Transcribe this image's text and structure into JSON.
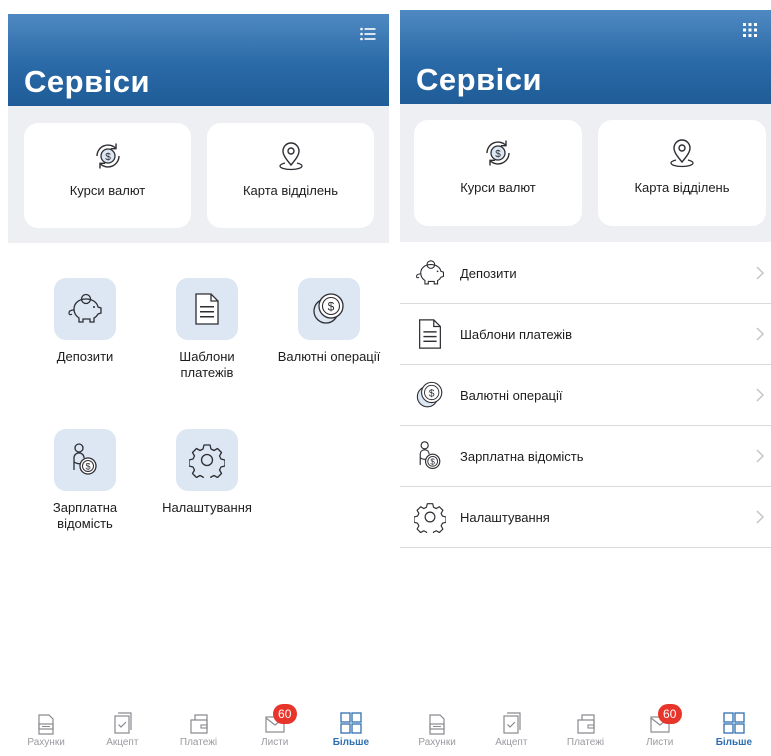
{
  "left_screen": {
    "title": "Сервіси",
    "view_toggle_icon": "list-icon",
    "quick_actions": [
      {
        "label": "Курси валют",
        "icon": "currency-exchange-icon"
      },
      {
        "label": "Карта відділень",
        "icon": "map-pin-icon"
      }
    ],
    "grid_items": [
      {
        "label": "Депозити",
        "icon": "piggy-bank-icon"
      },
      {
        "label": "Шаблони платежів",
        "icon": "document-icon"
      },
      {
        "label": "Валютні операції",
        "icon": "coin-icon"
      },
      {
        "label": "Зарплатна відомість",
        "icon": "salary-person-icon"
      },
      {
        "label": "Налаштування",
        "icon": "gear-icon"
      }
    ]
  },
  "right_screen": {
    "title": "Сервіси",
    "view_toggle_icon": "grid-icon",
    "quick_actions": [
      {
        "label": "Курси валют",
        "icon": "currency-exchange-icon"
      },
      {
        "label": "Карта відділень",
        "icon": "map-pin-icon"
      }
    ],
    "list_items": [
      {
        "label": "Депозити",
        "icon": "piggy-bank-icon"
      },
      {
        "label": "Шаблони платежів",
        "icon": "document-icon"
      },
      {
        "label": "Валютні операції",
        "icon": "coin-icon"
      },
      {
        "label": "Зарплатна відомість",
        "icon": "salary-person-icon"
      },
      {
        "label": "Налаштування",
        "icon": "gear-icon"
      }
    ]
  },
  "tabbar": {
    "items": [
      {
        "label": "Рахунки",
        "icon": "accounts-icon",
        "active": false
      },
      {
        "label": "Акцепт",
        "icon": "accept-icon",
        "active": false
      },
      {
        "label": "Платежі",
        "icon": "payments-icon",
        "active": false
      },
      {
        "label": "Листи",
        "icon": "letters-icon",
        "active": false,
        "badge": "60"
      },
      {
        "label": "Більше",
        "icon": "more-grid-icon",
        "active": true
      }
    ]
  },
  "colors": {
    "header_top": "#4f89c2",
    "header_bottom": "#1f5c98",
    "accent": "#2f6fb0",
    "badge": "#e8352b",
    "tile_bg": "#dce7f3",
    "band_bg": "#eeeff3"
  }
}
